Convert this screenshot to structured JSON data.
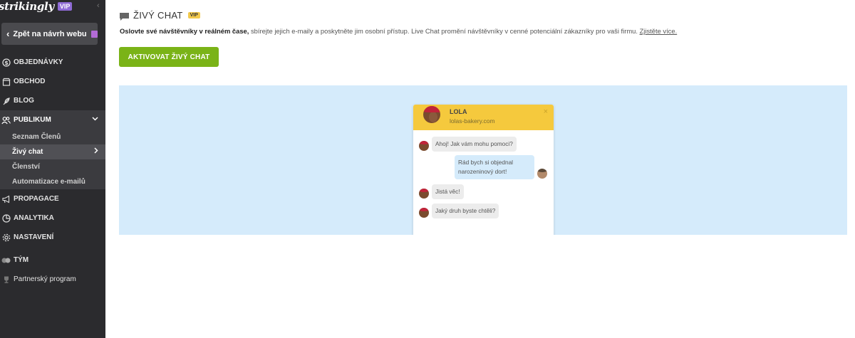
{
  "sidebar": {
    "brand": "strikingly",
    "brand_badge": "VIP",
    "back_label": "Zpět na návrh webu",
    "items": [
      {
        "label": "OBJEDNÁVKY",
        "icon": "dollar-circle-icon"
      },
      {
        "label": "OBCHOD",
        "icon": "store-icon"
      },
      {
        "label": "BLOG",
        "icon": "feather-icon"
      },
      {
        "label": "PUBLIKUM",
        "icon": "people-icon"
      },
      {
        "label": "PROPAGACE",
        "icon": "megaphone-icon"
      },
      {
        "label": "ANALYTIKA",
        "icon": "pie-chart-icon"
      },
      {
        "label": "NASTAVENÍ",
        "icon": "gear-icon"
      },
      {
        "label": "TÝM",
        "icon": "team-icon"
      },
      {
        "label": "Partnerský program",
        "icon": "trophy-icon"
      }
    ],
    "sub_items": [
      {
        "label": "Seznam Členů"
      },
      {
        "label": "Živý chat"
      },
      {
        "label": "Členství"
      },
      {
        "label": "Automatizace e-mailů"
      }
    ]
  },
  "main": {
    "title": "ŽIVÝ CHAT",
    "title_badge": "VIP",
    "desc_bold": "Oslovte své návštěvníky v reálném čase,",
    "desc_text": " sbírejte jejich e-maily a poskytněte jim osobní přístup. Live Chat promění návštěvníky v cenné potenciální zákazníky pro vaši firmu. ",
    "desc_link": "Zjistěte více.",
    "activate_label": "AKTIVOVAT ŽIVÝ CHAT"
  },
  "widget": {
    "name": "LOLA",
    "site": "lolas-bakery.com",
    "close": "×",
    "messages": [
      {
        "text": "Ahoj! Jak vám mohu pomoci?",
        "from": "agent"
      },
      {
        "text_line1": "Rád bych si objednal",
        "text_line2": "narozeninový dort!",
        "from": "visitor"
      },
      {
        "text": "Jistá věc!",
        "from": "agent"
      },
      {
        "text": "Jaký druh byste chtěli?",
        "from": "agent"
      }
    ]
  },
  "colors": {
    "sidebar_bg": "#2b2b2e",
    "accent_green": "#7ab317",
    "preview_bg": "#d5ebfb",
    "widget_header": "#f5c93d",
    "vip_purple": "#8f6bd6",
    "vip_yellow": "#f2c94c"
  }
}
